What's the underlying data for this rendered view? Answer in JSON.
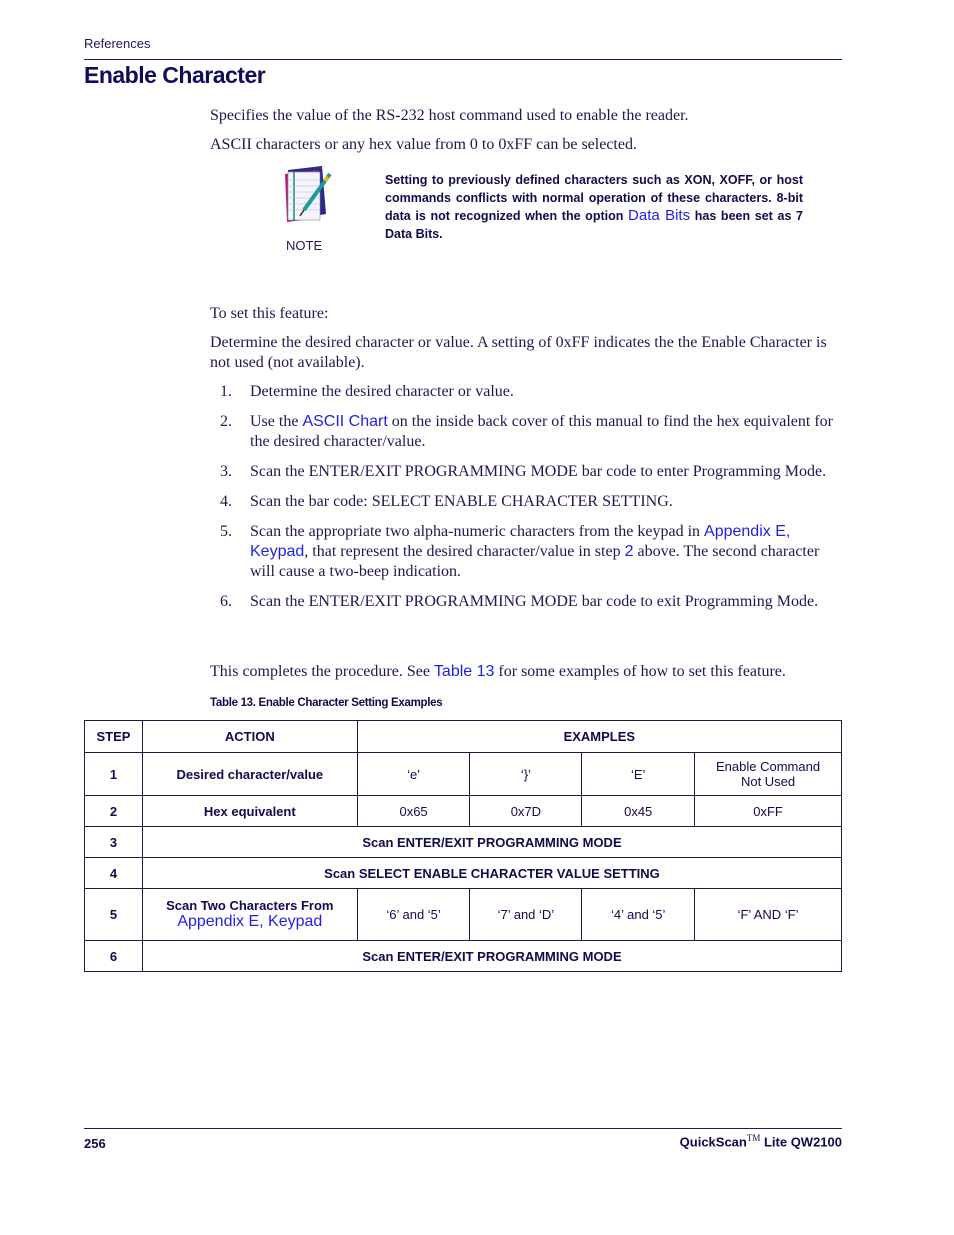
{
  "header": {
    "section": "References"
  },
  "page_title": "Enable Character",
  "intro": {
    "p1": "Specifies the value of the RS-232 host command used to enable the reader.",
    "p2": "ASCII characters or any hex value from 0 to 0xFF can be selected."
  },
  "note": {
    "icon": "notepad-pen-icon",
    "label": "NOTE",
    "text_before": "Setting to previously defined characters such as XON, XOFF, or host commands conflicts with normal operation of these characters. 8-bit data is not recognized when the option ",
    "link": "Data Bits",
    "text_after": " has been set as 7 Data Bits."
  },
  "procedure": {
    "lead": "To set this feature:",
    "desc": "Determine the desired character or value. A setting of 0xFF indicates the the Enable Character is not used (not available).",
    "steps": [
      {
        "num": "1.",
        "text": "Determine the desired character or value."
      },
      {
        "num": "2.",
        "pre": "Use the ",
        "link": "ASCII Chart",
        "post": " on the inside back cover of this manual to find the hex equivalent for the desired character/value."
      },
      {
        "num": "3.",
        "text": "Scan the ENTER/EXIT PROGRAMMING MODE bar code to enter Programming Mode."
      },
      {
        "num": "4.",
        "text": "Scan the bar code: SELECT ENABLE CHARACTER SETTING."
      },
      {
        "num": "5.",
        "pre": "Scan the appropriate two alpha-numeric characters from the keypad in ",
        "link": "Appendix E, Keypad",
        "mid": ", that represent the desired character/value in step ",
        "link2": "2",
        "post": " above. The second character will cause a two-beep indication."
      },
      {
        "num": "6.",
        "text": "Scan the ENTER/EXIT PROGRAMMING MODE bar code to exit Programming Mode."
      }
    ],
    "closing_pre": "This completes the procedure. See ",
    "closing_link": "Table 13",
    "closing_post": " for some examples of how to set this feature."
  },
  "table": {
    "caption": "Table 13. Enable Character Setting Examples",
    "headers": {
      "step": "STEP",
      "action": "ACTION",
      "examples": "EXAMPLES"
    },
    "rows": [
      {
        "step": "1",
        "action": "Desired character/value",
        "values": [
          "‘e’",
          "‘}’",
          "‘E’",
          "Enable Command Not Used"
        ]
      },
      {
        "step": "2",
        "action": "Hex equivalent",
        "values": [
          "0x65",
          "0x7D",
          "0x45",
          "0xFF"
        ]
      },
      {
        "step": "3",
        "span": "Scan ENTER/EXIT PROGRAMMING MODE"
      },
      {
        "step": "4",
        "span": "Scan SELECT ENABLE CHARACTER VALUE SETTING"
      },
      {
        "step": "5",
        "action": "Scan Two Characters From",
        "action_link": "Appendix E, Keypad",
        "values": [
          "‘6’ and ‘5’",
          "‘7’ and ‘D’",
          "‘4’ and ‘5’",
          "‘F’ AND ‘F’"
        ]
      },
      {
        "step": "6",
        "span": "Scan ENTER/EXIT PROGRAMMING MODE"
      }
    ]
  },
  "footer": {
    "page_number": "256",
    "product_name": "QuickScan",
    "trademark": "TM",
    "product_model": " Lite QW2100"
  }
}
